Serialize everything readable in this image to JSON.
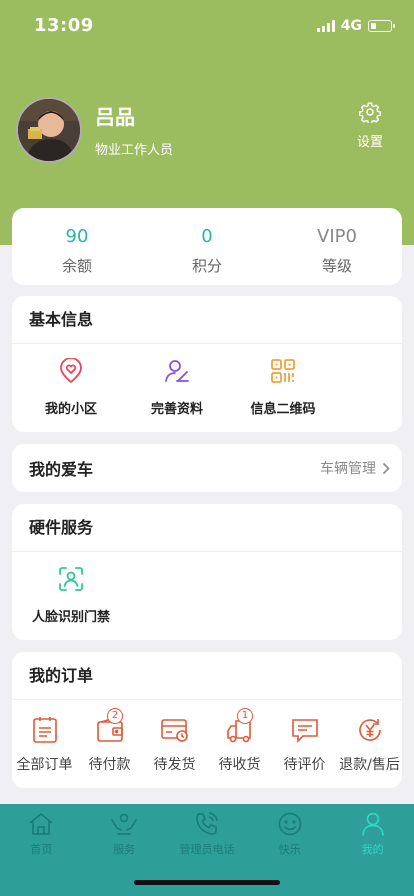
{
  "status_bar": {
    "time": "13:09",
    "network": "4G",
    "battery_level": 0.25
  },
  "profile": {
    "name": "吕品",
    "role": "物业工作人员",
    "settings_label": "设置"
  },
  "stats": [
    {
      "value": "90",
      "label": "余额",
      "color": "#2bb5a5"
    },
    {
      "value": "0",
      "label": "积分",
      "color": "#2bb5a5"
    },
    {
      "value": "VIP0",
      "label": "等级",
      "color": "#888888"
    }
  ],
  "basic_info": {
    "title": "基本信息",
    "items": [
      {
        "label": "我的小区",
        "icon": "heart-location-icon"
      },
      {
        "label": "完善资料",
        "icon": "user-edit-icon"
      },
      {
        "label": "信息二维码",
        "icon": "qr-code-icon"
      }
    ]
  },
  "car": {
    "title": "我的爱车",
    "link_label": "车辆管理"
  },
  "hardware": {
    "title": "硬件服务",
    "items": [
      {
        "label": "人脸识别门禁",
        "icon": "face-scan-icon"
      }
    ]
  },
  "orders": {
    "title": "我的订单",
    "items": [
      {
        "label": "全部订单",
        "icon": "order-list-icon",
        "badge": ""
      },
      {
        "label": "待付款",
        "icon": "wallet-icon",
        "badge": "2"
      },
      {
        "label": "待发货",
        "icon": "card-clock-icon",
        "badge": ""
      },
      {
        "label": "待收货",
        "icon": "truck-icon",
        "badge": "1"
      },
      {
        "label": "待评价",
        "icon": "comment-icon",
        "badge": ""
      },
      {
        "label": "退款/售后",
        "icon": "refund-icon",
        "badge": ""
      }
    ]
  },
  "tabbar": {
    "tabs": [
      {
        "label": "首页",
        "icon": "home-icon"
      },
      {
        "label": "服务",
        "icon": "service-hands-icon"
      },
      {
        "label": "管理员电话",
        "icon": "phone-icon"
      },
      {
        "label": "快乐",
        "icon": "smile-icon"
      },
      {
        "label": "我的",
        "icon": "user-icon"
      }
    ],
    "active": "我的"
  },
  "colors": {
    "header": "#9cbd5f",
    "accent": "#2bb5a5",
    "tabbar": "#2d9e98",
    "order_icon": "#e2583a"
  }
}
